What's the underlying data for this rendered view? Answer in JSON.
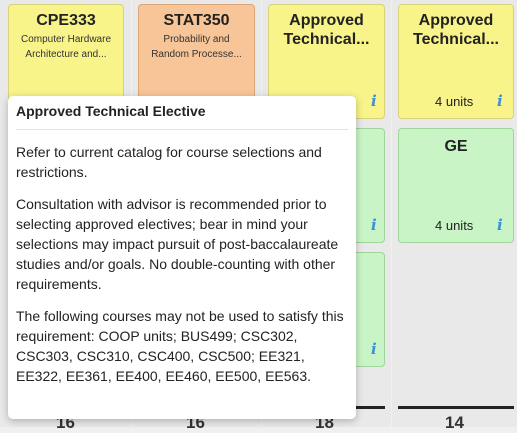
{
  "columns": [
    {
      "total": "16",
      "cards": [
        {
          "title": "CPE333",
          "subtitle": "Computer Hardware Architecture and...",
          "units": ""
        }
      ]
    },
    {
      "total": "16",
      "cards": [
        {
          "title": "STAT350",
          "subtitle": "Probability and Random Processe...",
          "units": ""
        }
      ]
    },
    {
      "total": "18",
      "cards": [
        {
          "title": "Approved Technical...",
          "units": ""
        },
        {
          "title": "",
          "units": ""
        },
        {
          "title": "",
          "units": ""
        }
      ]
    },
    {
      "total": "14",
      "cards": [
        {
          "title": "Approved Technical...",
          "units": "4 units"
        },
        {
          "title": "GE",
          "units": "4 units"
        }
      ]
    }
  ],
  "info_glyph": "i",
  "tooltip": {
    "heading": "Approved Technical Elective",
    "paragraphs": [
      "Refer to current catalog for course selections and restrictions.",
      "Consultation with advisor is recommended prior to selecting approved electives; bear in mind your selections may impact pursuit of post-baccalaureate studies and/or goals. No double-counting with other requirements.",
      "The following courses may not be used to satisfy this requirement: COOP units; BUS499; CSC302, CSC303, CSC310, CSC400, CSC500; EE321, EE322, EE361, EE400, EE460, EE500, EE563."
    ]
  },
  "colors": {
    "yellow": "#f8f48a",
    "orange": "#f7c597",
    "green": "#c9f5c6",
    "info": "#3a8fd6"
  }
}
